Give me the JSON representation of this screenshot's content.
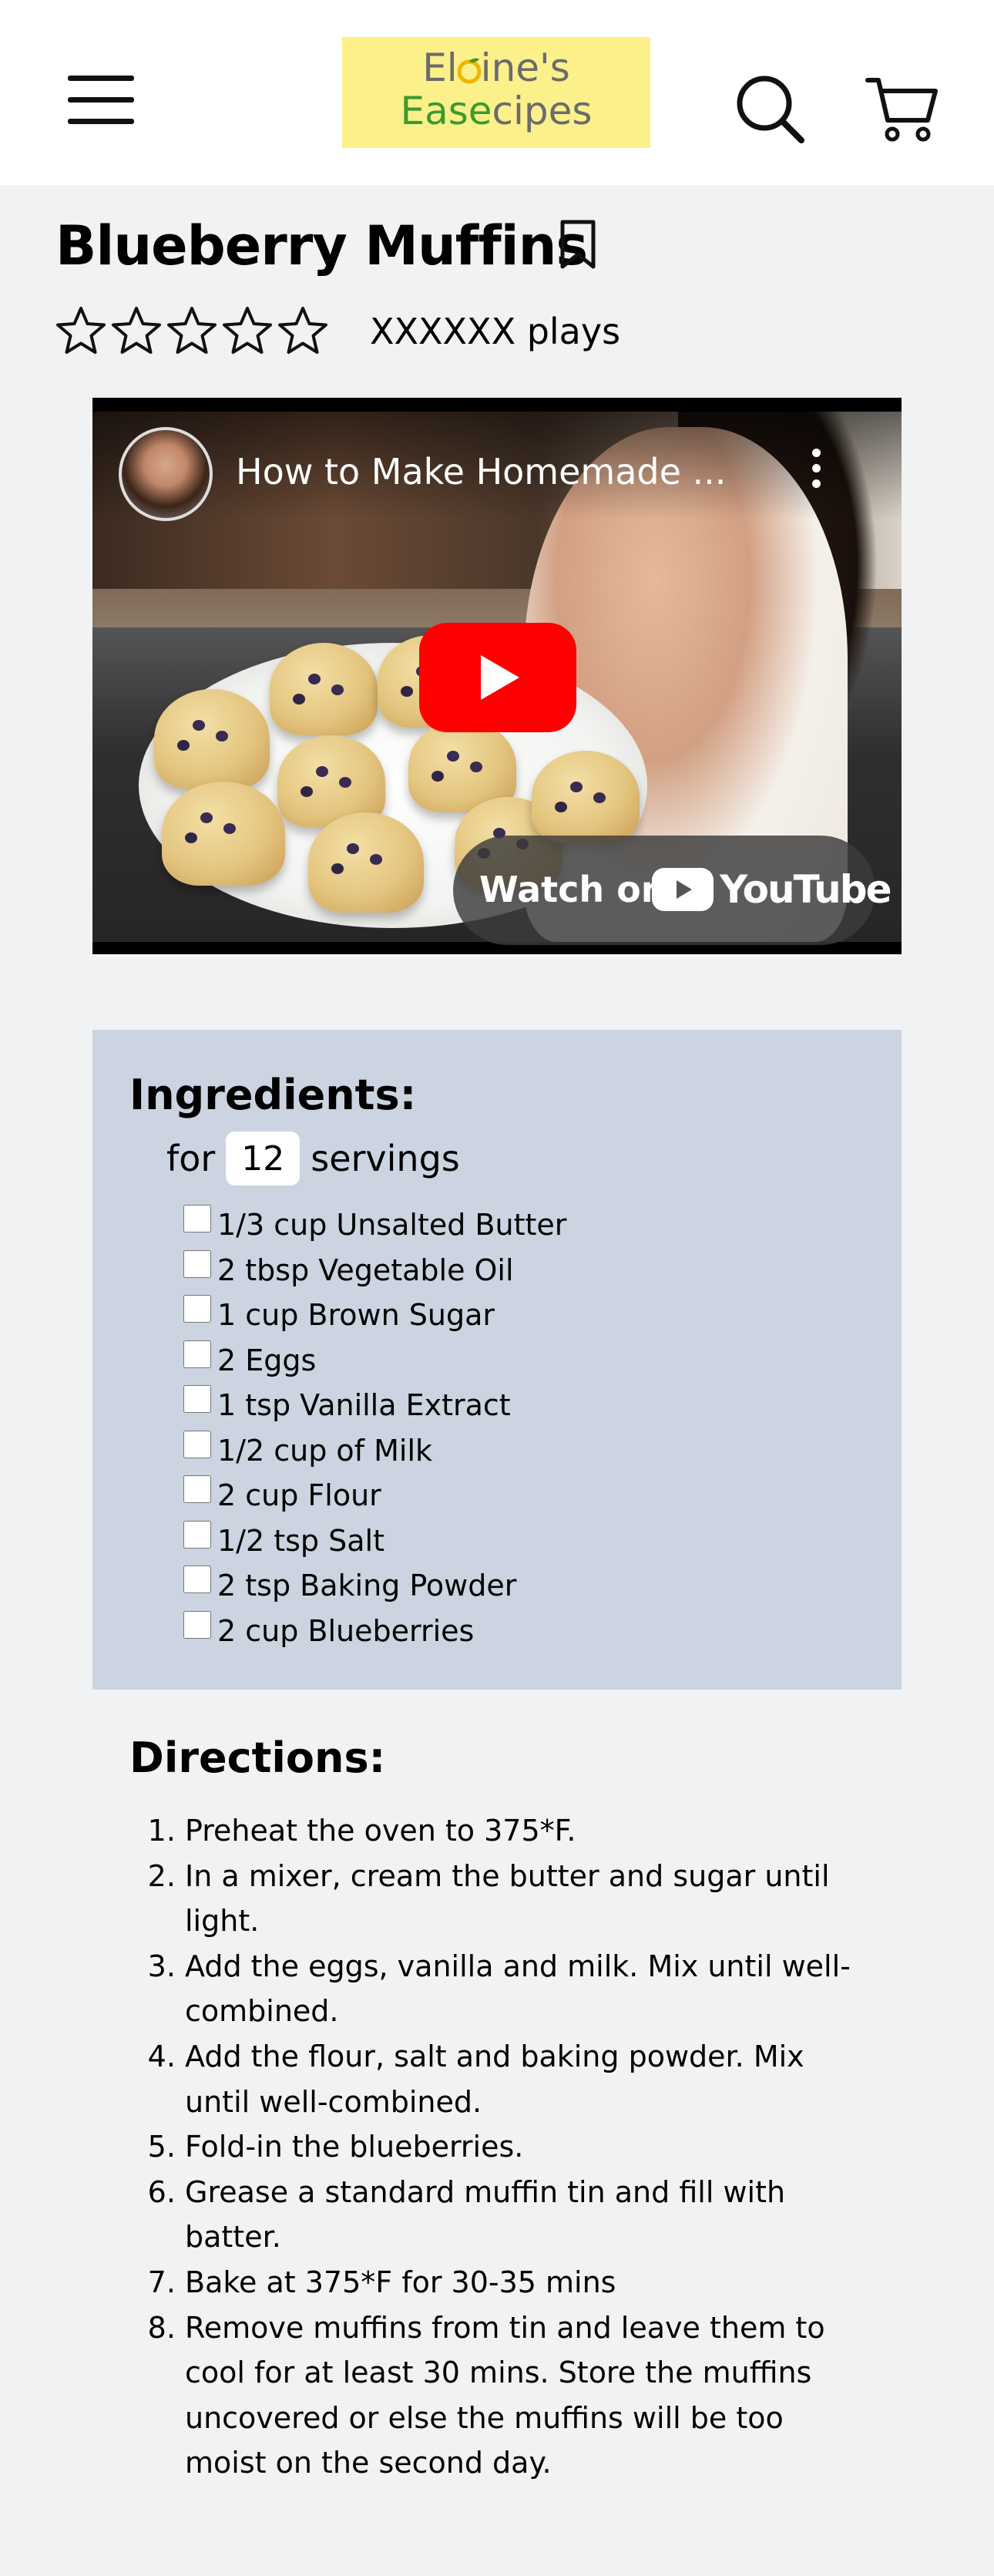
{
  "header": {
    "logo_line1": "El  ine's",
    "logo_line2_a": "Ease",
    "logo_line2_b": "cipes",
    "colors": {
      "logo_bg": "#fbf08a",
      "logo_green": "#3c9a2e",
      "logo_gray": "#6b6b6b"
    },
    "icons": [
      "hamburger-menu-icon",
      "search-icon",
      "cart-icon"
    ]
  },
  "recipe": {
    "title": "Blueberry Muffins",
    "rating": 0,
    "plays": "XXXXXX plays"
  },
  "video": {
    "title": "How to Make Homemade ...",
    "watch_label": "Watch on",
    "youtube_label": "YouTube"
  },
  "ingredients": {
    "heading": "Ingredients:",
    "for_label": "for",
    "servings_value": "12",
    "servings_label": "servings",
    "items": [
      "1/3 cup Unsalted Butter",
      "2 tbsp Vegetable Oil",
      "1 cup Brown Sugar",
      "2 Eggs",
      "1 tsp Vanilla Extract",
      "1/2 cup of Milk",
      "2 cup Flour",
      "1/2 tsp Salt",
      "2 tsp Baking Powder",
      "2 cup Blueberries"
    ]
  },
  "directions": {
    "heading": "Directions:",
    "steps": [
      "Preheat the oven to 375*F.",
      "In a mixer, cream the butter and sugar until light.",
      "Add the eggs, vanilla and milk. Mix until well-combined.",
      "Add the flour, salt and baking powder. Mix until well-combined.",
      "Fold-in the blueberries.",
      "Grease a standard muffin tin and fill with batter.",
      "Bake at 375*F for 30-35 mins",
      "Remove muffins from tin and leave them to cool for at least 30 mins. Store the muffins uncovered or else the muffins will be too moist on the second day."
    ]
  }
}
